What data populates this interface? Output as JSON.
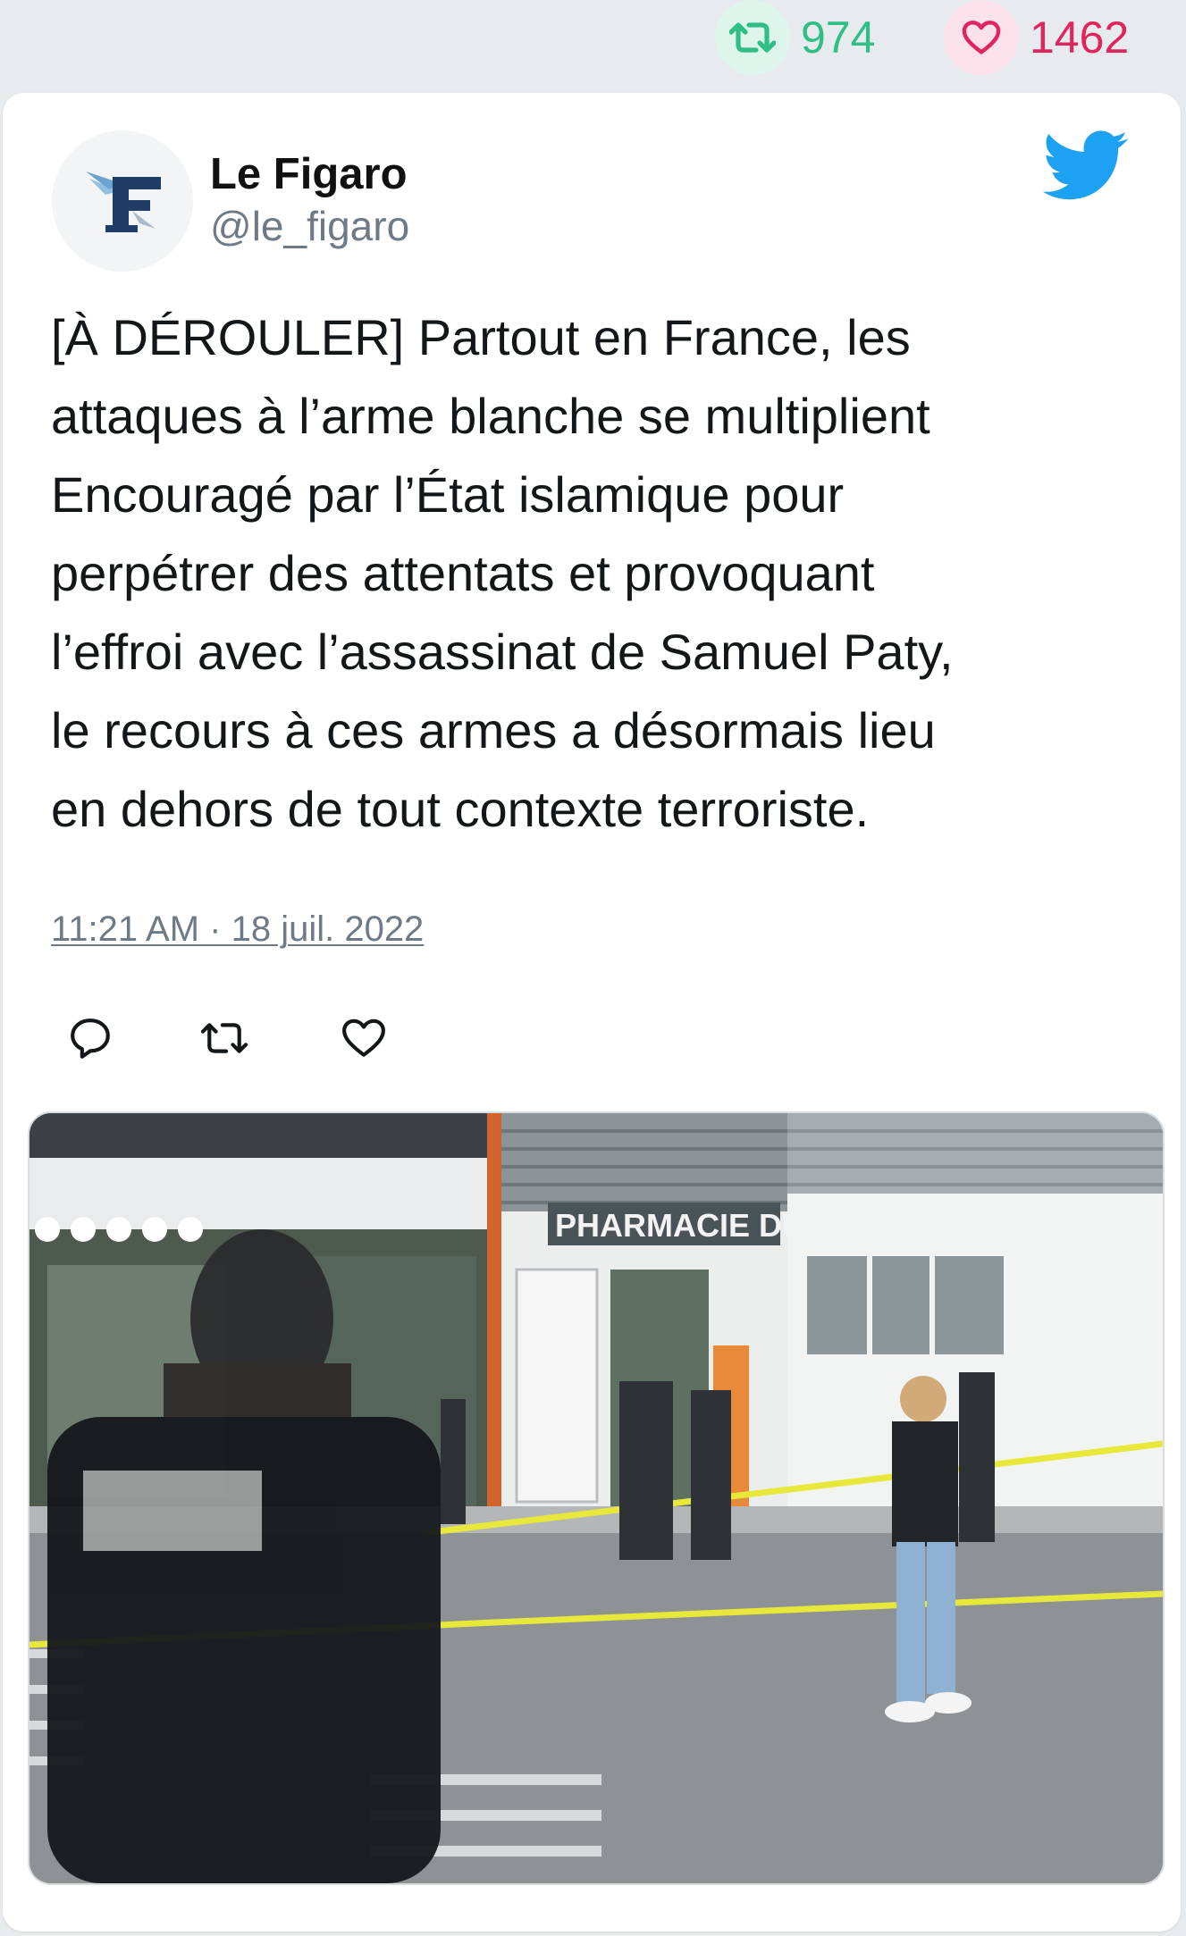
{
  "stats": {
    "retweets": "974",
    "likes": "1462",
    "retweet_icon": "retweet-icon",
    "like_icon": "heart-icon"
  },
  "author": {
    "display_name": "Le Figaro",
    "handle": "@le_figaro",
    "avatar_icon": "le-figaro-logo"
  },
  "tweet": {
    "lines": [
      "[À DÉROULER] Partout en France, les",
      "attaques à l’arme blanche se multiplient",
      "Encouragé par l’État islamique pour",
      "perpétrer des attentats et provoquant",
      "l’effroi avec l’assassinat de Samuel Paty,",
      "le recours à ces armes a désormais lieu",
      "en dehors de tout contexte terroriste."
    ],
    "timestamp": "11:21 AM · 18 juil. 2022"
  },
  "actions": {
    "reply_icon": "reply-icon",
    "retweet_icon": "retweet-icon",
    "like_icon": "heart-icon"
  },
  "media": {
    "storefront_sign": "PHARMACIE DU ME"
  },
  "colors": {
    "retweet": "#2fbe86",
    "like": "#e0245e",
    "twitter_blue": "#1da1f2",
    "muted": "#6e7b87"
  }
}
